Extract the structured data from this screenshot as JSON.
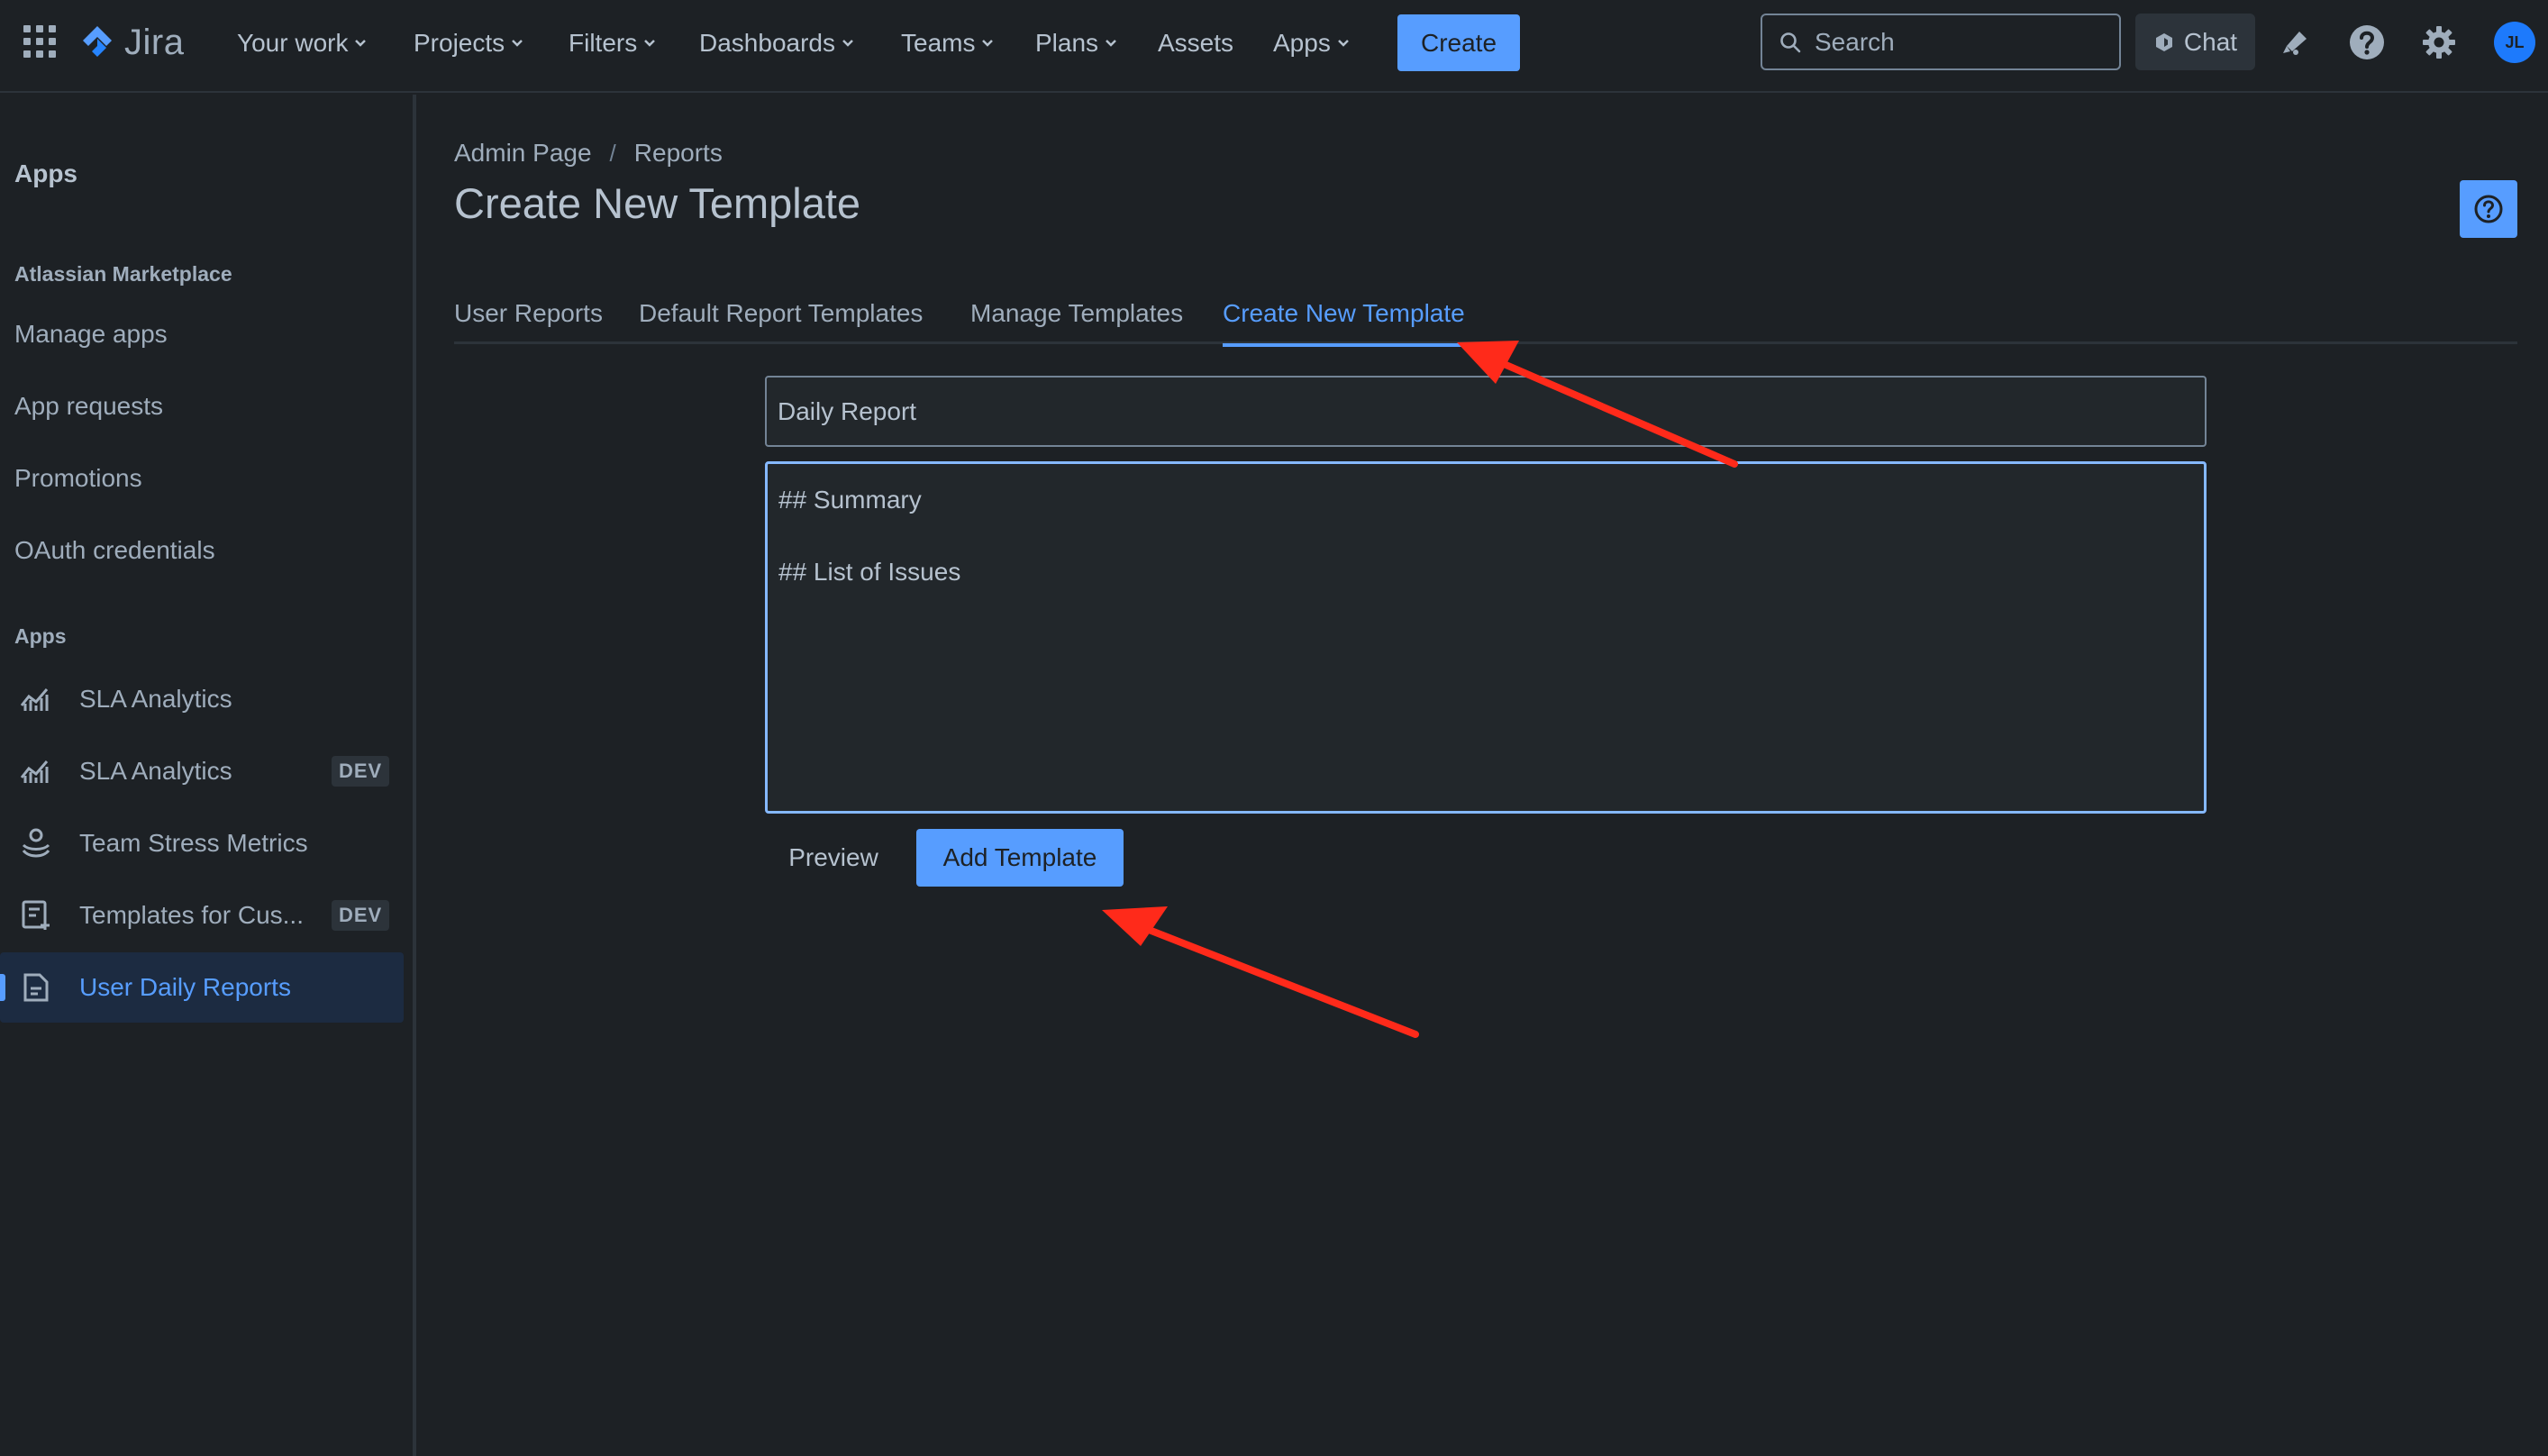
{
  "topnav": {
    "logo_text": "Jira",
    "items": [
      {
        "label": "Your work",
        "dropdown": true
      },
      {
        "label": "Projects",
        "dropdown": true
      },
      {
        "label": "Filters",
        "dropdown": true
      },
      {
        "label": "Dashboards",
        "dropdown": true
      },
      {
        "label": "Teams",
        "dropdown": true
      },
      {
        "label": "Plans",
        "dropdown": true
      },
      {
        "label": "Assets",
        "dropdown": false
      },
      {
        "label": "Apps",
        "dropdown": true
      }
    ],
    "create_label": "Create",
    "search_placeholder": "Search",
    "chat_label": "Chat",
    "avatar_initials": "JL"
  },
  "sidebar": {
    "title": "Apps",
    "marketplace_section": "Atlassian Marketplace",
    "marketplace_links": [
      "Manage apps",
      "App requests",
      "Promotions",
      "OAuth credentials"
    ],
    "apps_section": "Apps",
    "apps": [
      {
        "label": "SLA Analytics",
        "icon": "chart-line-icon",
        "badge": ""
      },
      {
        "label": "SLA Analytics",
        "icon": "chart-line-icon",
        "badge": "DEV"
      },
      {
        "label": "Team Stress Metrics",
        "icon": "person-meter-icon",
        "badge": ""
      },
      {
        "label": "Templates for Cus...",
        "icon": "template-add-icon",
        "badge": "DEV"
      },
      {
        "label": "User Daily Reports",
        "icon": "document-icon",
        "badge": "",
        "active": true
      }
    ]
  },
  "main": {
    "breadcrumb": [
      "Admin Page",
      "Reports"
    ],
    "breadcrumb_sep": "/",
    "title": "Create New Template",
    "tabs": [
      {
        "label": "User Reports"
      },
      {
        "label": "Default Report Templates"
      },
      {
        "label": "Manage Templates"
      },
      {
        "label": "Create New Template",
        "active": true
      }
    ],
    "template_name": "Daily Report",
    "template_body": "## Summary\n## List of Issues",
    "preview_label": "Preview",
    "add_label": "Add Template"
  },
  "colors": {
    "background": "#1d2125",
    "accent": "#579dff",
    "text": "#b6c2cf",
    "annotation_arrow": "#ff2a1a"
  }
}
